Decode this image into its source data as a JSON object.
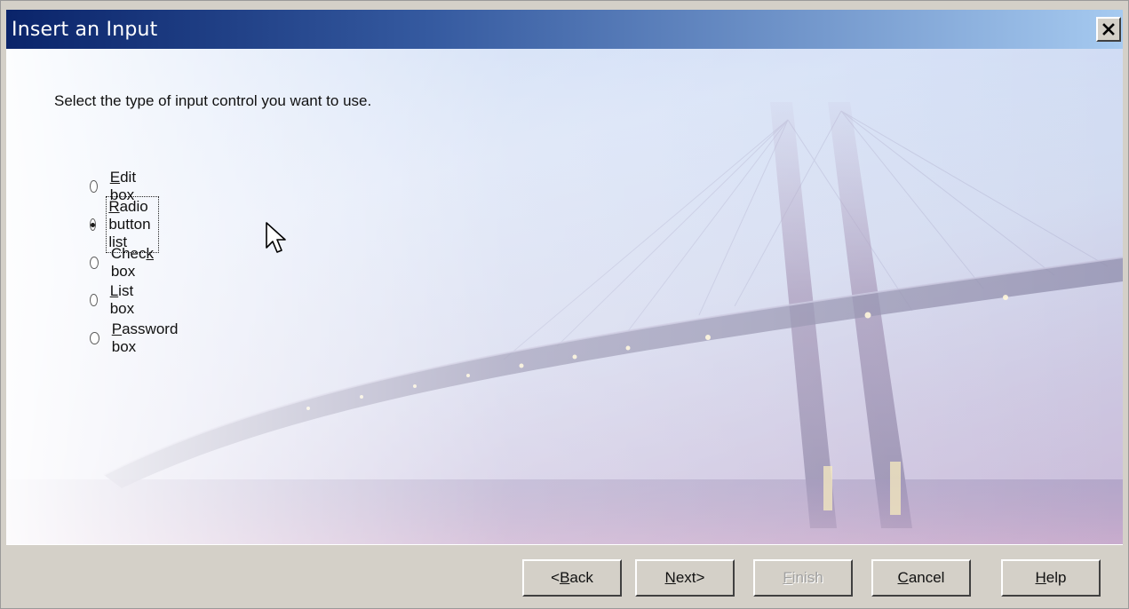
{
  "window": {
    "title": "Insert an Input",
    "close_label": "×"
  },
  "instruction": "Select the type of input control you want to use.",
  "options": [
    {
      "before": "",
      "accel": "E",
      "after": "dit box",
      "selected": false
    },
    {
      "before": "",
      "accel": "R",
      "after": "adio button list",
      "selected": true
    },
    {
      "before": "Chec",
      "accel": "k",
      "after": " box",
      "selected": false
    },
    {
      "before": "",
      "accel": "L",
      "after": "ist box",
      "selected": false
    },
    {
      "before": "",
      "accel": "P",
      "after": "assword box",
      "selected": false
    }
  ],
  "buttons": {
    "back": {
      "before": "<",
      "accel": "B",
      "after": "ack"
    },
    "next": {
      "before": "",
      "accel": "N",
      "after": "ext>"
    },
    "finish": {
      "before": "",
      "accel": "F",
      "after": "inish",
      "disabled": true
    },
    "cancel": {
      "before": "",
      "accel": "C",
      "after": "ancel"
    },
    "help": {
      "before": "",
      "accel": "H",
      "after": "elp"
    }
  },
  "colors": {
    "titlebar_start": "#0a246a",
    "titlebar_end": "#a6caf0",
    "dialog_face": "#d4d0c8"
  }
}
